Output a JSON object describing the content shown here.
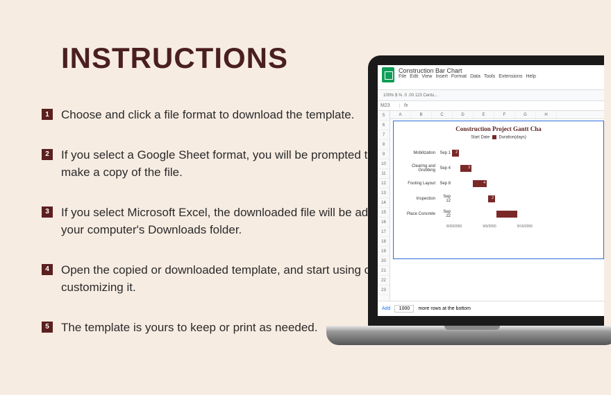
{
  "title": "INSTRUCTIONS",
  "steps": [
    {
      "num": "1",
      "text": "Choose and click a file format to download the template."
    },
    {
      "num": "2",
      "text": "If you select a Google Sheet format, you will be prompted to make a copy of the file."
    },
    {
      "num": "3",
      "text": "If you select Microsoft Excel, the downloaded file will be added to your computer's Downloads folder."
    },
    {
      "num": "4",
      "text": "Open the copied or downloaded template, and start using or customizing it."
    },
    {
      "num": "5",
      "text": "The template is yours to keep or print as needed."
    }
  ],
  "sheet": {
    "doc_title": "Construction Bar Chart",
    "menu": [
      "File",
      "Edit",
      "View",
      "Insert",
      "Format",
      "Data",
      "Tools",
      "Extensions",
      "Help"
    ],
    "toolbar": "100%   $  %  .0  .00  123   Centu...",
    "cell_ref": "M23",
    "fx": "fx",
    "cols": [
      "A",
      "B",
      "C",
      "D",
      "E",
      "F",
      "G",
      "H"
    ],
    "rows": [
      "5",
      "6",
      "7",
      "8",
      "9",
      "10",
      "11",
      "12",
      "13",
      "14",
      "15",
      "16",
      "17",
      "18",
      "19",
      "20",
      "21",
      "22",
      "23"
    ],
    "footer_add": "Add",
    "footer_rows": "1000",
    "footer_text": "more rows at the bottom"
  },
  "chart_data": {
    "type": "bar",
    "title": "Construction Project Gantt Cha",
    "legend": {
      "startdate": "Start Date",
      "duration": "Duration(days)"
    },
    "tasks": [
      {
        "name": "Mobilization",
        "start_label": "Sep 1",
        "duration": 2,
        "offset": 0,
        "width": 10
      },
      {
        "name": "Clearing and Grubbing",
        "start_label": "Sep 4",
        "duration": 3,
        "offset": 12,
        "width": 16
      },
      {
        "name": "Footing Layout",
        "start_label": "Sep 8",
        "duration": 4,
        "offset": 30,
        "width": 20
      },
      {
        "name": "Inspection",
        "start_label": "Sep 12",
        "duration": 2,
        "offset": 52,
        "width": 10
      },
      {
        "name": "Place Concrete",
        "start_label": "Sep 22",
        "duration": "",
        "offset": 64,
        "width": 30
      }
    ],
    "xaxis": [
      "8/30/2050",
      "9/9/2050",
      "9/19/2050"
    ]
  }
}
